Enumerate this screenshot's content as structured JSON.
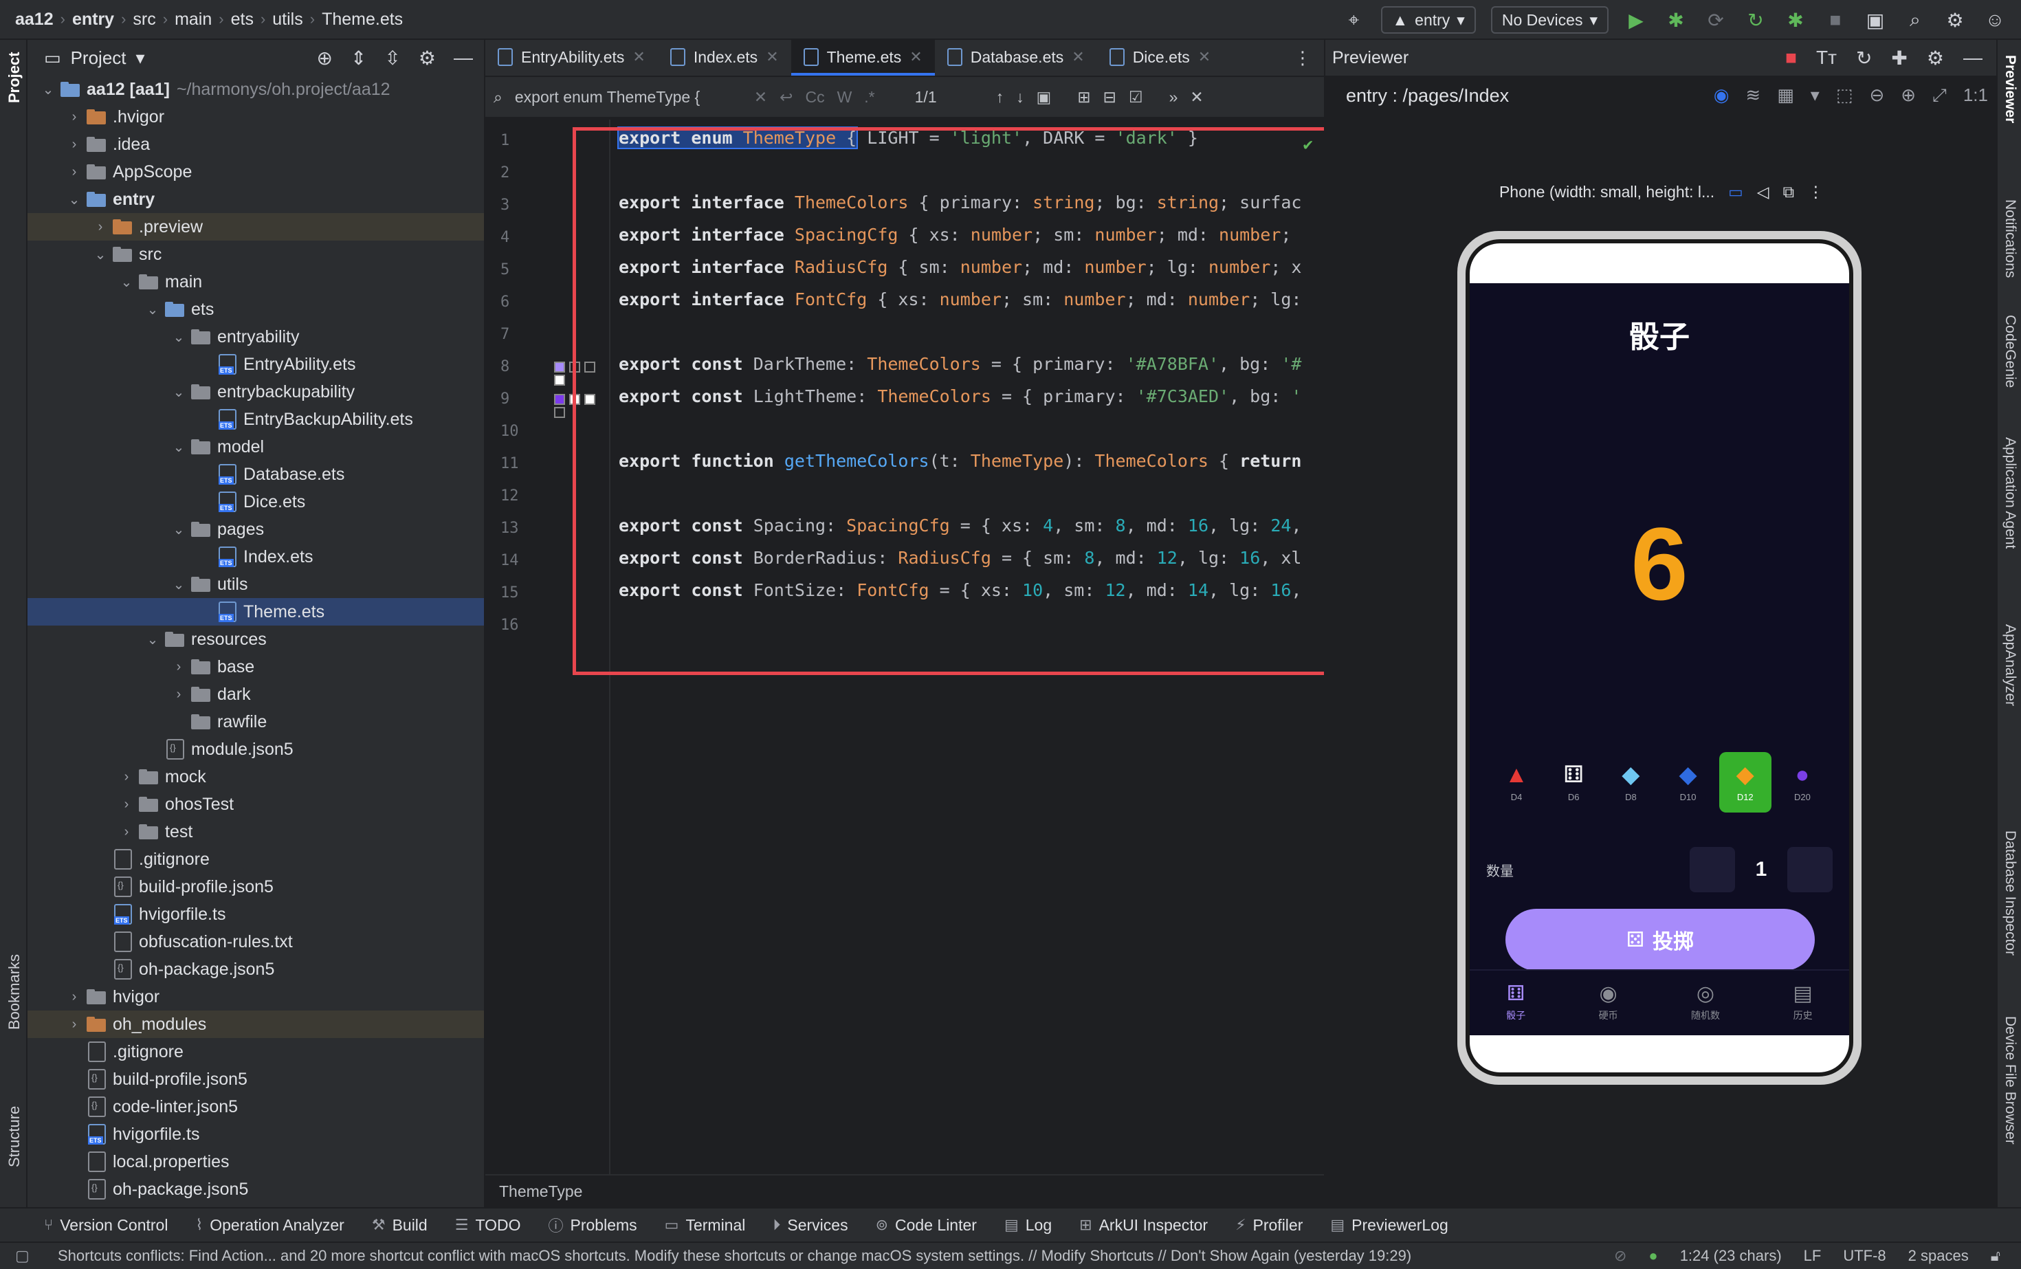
{
  "breadcrumb": [
    "aa12",
    "entry",
    "src",
    "main",
    "ets",
    "utils",
    "Theme.ets"
  ],
  "toolbar": {
    "run_config": "entry",
    "device": "No Devices"
  },
  "left_strip": {
    "project": "Project",
    "bookmarks": "Bookmarks",
    "structure": "Structure"
  },
  "project_panel": {
    "title": "Project",
    "tree": [
      {
        "label": "aa12 [aa1]",
        "suffix": "~/harmonys/oh.project/aa12",
        "depth": 0,
        "type": "folder-b",
        "open": true,
        "bold": true
      },
      {
        "label": ".hvigor",
        "depth": 1,
        "type": "folder-o",
        "open": false
      },
      {
        "label": ".idea",
        "depth": 1,
        "type": "folder",
        "open": false
      },
      {
        "label": "AppScope",
        "depth": 1,
        "type": "folder",
        "open": false
      },
      {
        "label": "entry",
        "depth": 1,
        "type": "folder-b",
        "open": true,
        "bold": true
      },
      {
        "label": ".preview",
        "depth": 2,
        "type": "folder-o",
        "open": false,
        "hl": true
      },
      {
        "label": "src",
        "depth": 2,
        "type": "folder",
        "open": true
      },
      {
        "label": "main",
        "depth": 3,
        "type": "folder",
        "open": true
      },
      {
        "label": "ets",
        "depth": 4,
        "type": "folder-b",
        "open": true
      },
      {
        "label": "entryability",
        "depth": 5,
        "type": "folder",
        "open": true
      },
      {
        "label": "EntryAbility.ets",
        "depth": 6,
        "type": "ts"
      },
      {
        "label": "entrybackupability",
        "depth": 5,
        "type": "folder",
        "open": true
      },
      {
        "label": "EntryBackupAbility.ets",
        "depth": 6,
        "type": "ts"
      },
      {
        "label": "model",
        "depth": 5,
        "type": "folder",
        "open": true
      },
      {
        "label": "Database.ets",
        "depth": 6,
        "type": "ts"
      },
      {
        "label": "Dice.ets",
        "depth": 6,
        "type": "ts"
      },
      {
        "label": "pages",
        "depth": 5,
        "type": "folder",
        "open": true
      },
      {
        "label": "Index.ets",
        "depth": 6,
        "type": "ts"
      },
      {
        "label": "utils",
        "depth": 5,
        "type": "folder",
        "open": true
      },
      {
        "label": "Theme.ets",
        "depth": 6,
        "type": "ts",
        "sel": true
      },
      {
        "label": "resources",
        "depth": 4,
        "type": "folder",
        "open": true
      },
      {
        "label": "base",
        "depth": 5,
        "type": "folder",
        "open": false
      },
      {
        "label": "dark",
        "depth": 5,
        "type": "folder",
        "open": false
      },
      {
        "label": "rawfile",
        "depth": 5,
        "type": "folder"
      },
      {
        "label": "module.json5",
        "depth": 4,
        "type": "json"
      },
      {
        "label": "mock",
        "depth": 3,
        "type": "folder",
        "open": false
      },
      {
        "label": "ohosTest",
        "depth": 3,
        "type": "folder",
        "open": false
      },
      {
        "label": "test",
        "depth": 3,
        "type": "folder",
        "open": false
      },
      {
        "label": ".gitignore",
        "depth": 2,
        "type": "file"
      },
      {
        "label": "build-profile.json5",
        "depth": 2,
        "type": "json"
      },
      {
        "label": "hvigorfile.ts",
        "depth": 2,
        "type": "ts"
      },
      {
        "label": "obfuscation-rules.txt",
        "depth": 2,
        "type": "file"
      },
      {
        "label": "oh-package.json5",
        "depth": 2,
        "type": "json"
      },
      {
        "label": "hvigor",
        "depth": 1,
        "type": "folder",
        "open": false
      },
      {
        "label": "oh_modules",
        "depth": 1,
        "type": "folder-o",
        "open": false,
        "hl": true
      },
      {
        "label": ".gitignore",
        "depth": 1,
        "type": "file"
      },
      {
        "label": "build-profile.json5",
        "depth": 1,
        "type": "json"
      },
      {
        "label": "code-linter.json5",
        "depth": 1,
        "type": "json"
      },
      {
        "label": "hvigorfile.ts",
        "depth": 1,
        "type": "ts"
      },
      {
        "label": "local.properties",
        "depth": 1,
        "type": "file"
      },
      {
        "label": "oh-package.json5",
        "depth": 1,
        "type": "json"
      }
    ]
  },
  "editor": {
    "tabs": [
      {
        "label": "EntryAbility.ets",
        "active": false
      },
      {
        "label": "Index.ets",
        "active": false
      },
      {
        "label": "Theme.ets",
        "active": true
      },
      {
        "label": "Database.ets",
        "active": false
      },
      {
        "label": "Dice.ets",
        "active": false
      }
    ],
    "find": {
      "query": "export enum ThemeType {",
      "case_label": "Cc",
      "word_label": "W",
      "regex_label": ".*",
      "count": "1/1"
    },
    "line_numbers": [
      "1",
      "2",
      "3",
      "4",
      "5",
      "6",
      "7",
      "8",
      "9",
      "10",
      "11",
      "12",
      "13",
      "14",
      "15",
      "16"
    ],
    "code_lines": [
      "export enum ThemeType { LIGHT = 'light', DARK = 'dark' }",
      "",
      "export interface ThemeColors { primary: string; bg: string; surfac",
      "export interface SpacingCfg { xs: number; sm: number; md: number;",
      "export interface RadiusCfg { sm: number; md: number; lg: number; x",
      "export interface FontCfg { xs: number; sm: number; md: number; lg:",
      "",
      "export const DarkTheme: ThemeColors = { primary: '#A78BFA', bg: '#",
      "export const LightTheme: ThemeColors = { primary: '#7C3AED', bg: '",
      "",
      "export function getThemeColors(t: ThemeType): ThemeColors { return",
      "",
      "export const Spacing: SpacingCfg = { xs: 4, sm: 8, md: 16, lg: 24,",
      "export const BorderRadius: RadiusCfg = { sm: 8, md: 12, lg: 16, xl",
      "export const FontSize: FontCfg = { xs: 10, sm: 12, md: 14, lg: 16,",
      ""
    ],
    "breadcrumb_bottom": "ThemeType"
  },
  "previewer": {
    "title": "Previewer",
    "route": "entry : /pages/Index",
    "device_label": "Phone (width: small, height: l...",
    "app": {
      "title": "骰子",
      "result": "6",
      "dice": [
        {
          "label": "D4",
          "glyph": "▲",
          "color": "#e53935",
          "active": false
        },
        {
          "label": "D6",
          "glyph": "⚅",
          "color": "#f0f0f0",
          "active": false
        },
        {
          "label": "D8",
          "glyph": "◆",
          "color": "#6fc7f2",
          "active": false
        },
        {
          "label": "D10",
          "glyph": "◆",
          "color": "#2f6be0",
          "active": false
        },
        {
          "label": "D12",
          "glyph": "◆",
          "color": "#f59b1f",
          "active": true
        },
        {
          "label": "D20",
          "glyph": "●",
          "color": "#7a3fe6",
          "active": false
        }
      ],
      "qty_label": "数量",
      "qty_value": "1",
      "roll_label": "投掷",
      "nav": [
        {
          "label": "骰子",
          "glyph": "⚅",
          "active": true
        },
        {
          "label": "硬币",
          "glyph": "◉",
          "active": false
        },
        {
          "label": "随机数",
          "glyph": "◎",
          "active": false
        },
        {
          "label": "历史",
          "glyph": "▤",
          "active": false
        }
      ]
    }
  },
  "right_strip": [
    "Previewer",
    "Notifications",
    "CodeGenie",
    "Application Agent",
    "AppAnalyzer",
    "Database Inspector",
    "Device File Browser"
  ],
  "bottom_tools": [
    "Version Control",
    "Operation Analyzer",
    "Build",
    "TODO",
    "Problems",
    "Terminal",
    "Services",
    "Code Linter",
    "Log",
    "ArkUI Inspector",
    "Profiler",
    "PreviewerLog"
  ],
  "status": {
    "message": "Shortcuts conflicts: Find Action... and 20 more shortcut conflict with macOS shortcuts. Modify these shortcuts or change macOS system settings. // Modify Shortcuts // Don't Show Again (yesterday 19:29)",
    "position": "1:24 (23 chars)",
    "line_sep": "LF",
    "encoding": "UTF-8",
    "indent": "2 spaces"
  },
  "colors": {
    "accent": "#3574f0",
    "highlight_box": "#e8464e",
    "primary": "#A78BFA",
    "result": "#f5a319"
  }
}
